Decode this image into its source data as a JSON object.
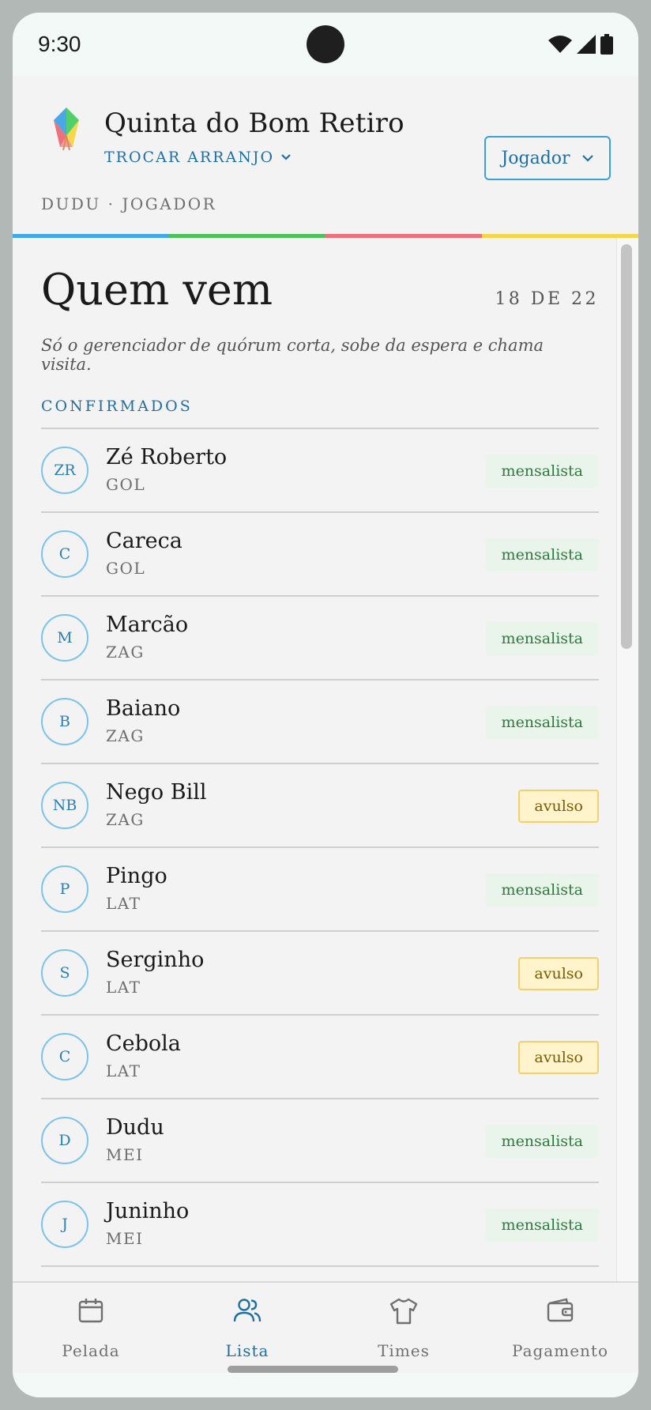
{
  "status": {
    "time": "9:30"
  },
  "header": {
    "title": "Quinta do Bom Retiro",
    "switch_label": "TROCAR ARRANJO",
    "role_value": "Jogador",
    "user_line": "DUDU · JOGADOR"
  },
  "strip_colors": [
    "#3ea9e4",
    "#4cc35a",
    "#ef6f7a",
    "#f4d84a"
  ],
  "page": {
    "title": "Quem vem",
    "count": "18 DE 22",
    "subtitle": "Só o gerenciador de quórum corta, sobe da espera e chama visita.",
    "section": "CONFIRMADOS"
  },
  "players": [
    {
      "initials": "ZR",
      "name": "Zé Roberto",
      "pos": "GOL",
      "type": "mensalista"
    },
    {
      "initials": "C",
      "name": "Careca",
      "pos": "GOL",
      "type": "mensalista"
    },
    {
      "initials": "M",
      "name": "Marcão",
      "pos": "ZAG",
      "type": "mensalista"
    },
    {
      "initials": "B",
      "name": "Baiano",
      "pos": "ZAG",
      "type": "mensalista"
    },
    {
      "initials": "NB",
      "name": "Nego Bill",
      "pos": "ZAG",
      "type": "avulso"
    },
    {
      "initials": "P",
      "name": "Pingo",
      "pos": "LAT",
      "type": "mensalista"
    },
    {
      "initials": "S",
      "name": "Serginho",
      "pos": "LAT",
      "type": "avulso"
    },
    {
      "initials": "C",
      "name": "Cebola",
      "pos": "LAT",
      "type": "avulso"
    },
    {
      "initials": "D",
      "name": "Dudu",
      "pos": "MEI",
      "type": "mensalista"
    },
    {
      "initials": "J",
      "name": "Juninho",
      "pos": "MEI",
      "type": "mensalista"
    }
  ],
  "nav": [
    {
      "label": "Pelada",
      "icon": "calendar-icon",
      "active": false
    },
    {
      "label": "Lista",
      "icon": "users-icon",
      "active": true
    },
    {
      "label": "Times",
      "icon": "shirt-icon",
      "active": false
    },
    {
      "label": "Pagamento",
      "icon": "wallet-icon",
      "active": false
    }
  ]
}
